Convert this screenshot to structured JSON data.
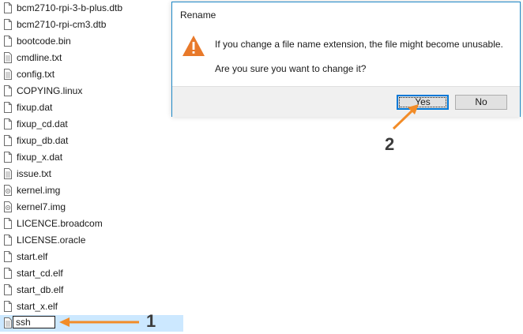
{
  "files": [
    {
      "name": "bcm2710-rpi-3-b-plus.dtb",
      "icon": "file-icon"
    },
    {
      "name": "bcm2710-rpi-cm3.dtb",
      "icon": "file-icon"
    },
    {
      "name": "bootcode.bin",
      "icon": "file-icon"
    },
    {
      "name": "cmdline.txt",
      "icon": "text-file-icon"
    },
    {
      "name": "config.txt",
      "icon": "text-file-icon"
    },
    {
      "name": "COPYING.linux",
      "icon": "file-icon"
    },
    {
      "name": "fixup.dat",
      "icon": "file-icon"
    },
    {
      "name": "fixup_cd.dat",
      "icon": "file-icon"
    },
    {
      "name": "fixup_db.dat",
      "icon": "file-icon"
    },
    {
      "name": "fixup_x.dat",
      "icon": "file-icon"
    },
    {
      "name": "issue.txt",
      "icon": "text-file-icon"
    },
    {
      "name": "kernel.img",
      "icon": "image-file-icon"
    },
    {
      "name": "kernel7.img",
      "icon": "image-file-icon"
    },
    {
      "name": "LICENCE.broadcom",
      "icon": "file-icon"
    },
    {
      "name": "LICENSE.oracle",
      "icon": "file-icon"
    },
    {
      "name": "start.elf",
      "icon": "file-icon"
    },
    {
      "name": "start_cd.elf",
      "icon": "file-icon"
    },
    {
      "name": "start_db.elf",
      "icon": "file-icon"
    },
    {
      "name": "start_x.elf",
      "icon": "file-icon"
    }
  ],
  "rename_row": {
    "value": "ssh",
    "icon": "text-file-icon"
  },
  "dialog": {
    "title": "Rename",
    "message_line1": "If you change a file name extension, the file might become unusable.",
    "message_line2": "Are you sure you want to change it?",
    "yes_label": "Yes",
    "no_label": "No",
    "icon": "warning-icon"
  },
  "annotations": {
    "step1": "1",
    "step2": "2",
    "arrow_color": "#f28c28"
  },
  "colors": {
    "selection": "#cce8ff",
    "dialog_border": "#1e88c7",
    "warning": "#e8792a"
  }
}
